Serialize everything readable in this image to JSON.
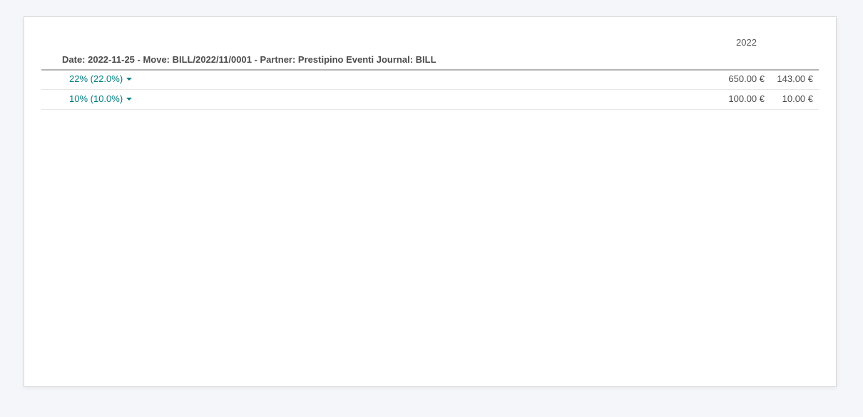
{
  "report": {
    "column_header": "2022",
    "group_title": "Date: 2022-11-25 - Move: BILL/2022/11/0001 - Partner: Prestipino Eventi Journal: BILL",
    "rows": [
      {
        "label": "22% (22.0%)",
        "base": "650.00 €",
        "tax": "143.00 €",
        "icon": "caret-down-icon"
      },
      {
        "label": "10% (10.0%)",
        "base": "100.00 €",
        "tax": "10.00 €",
        "icon": "caret-down-icon"
      }
    ]
  },
  "colors": {
    "link": "#017e84",
    "background": "#f5f6fa",
    "sheet": "#ffffff"
  }
}
